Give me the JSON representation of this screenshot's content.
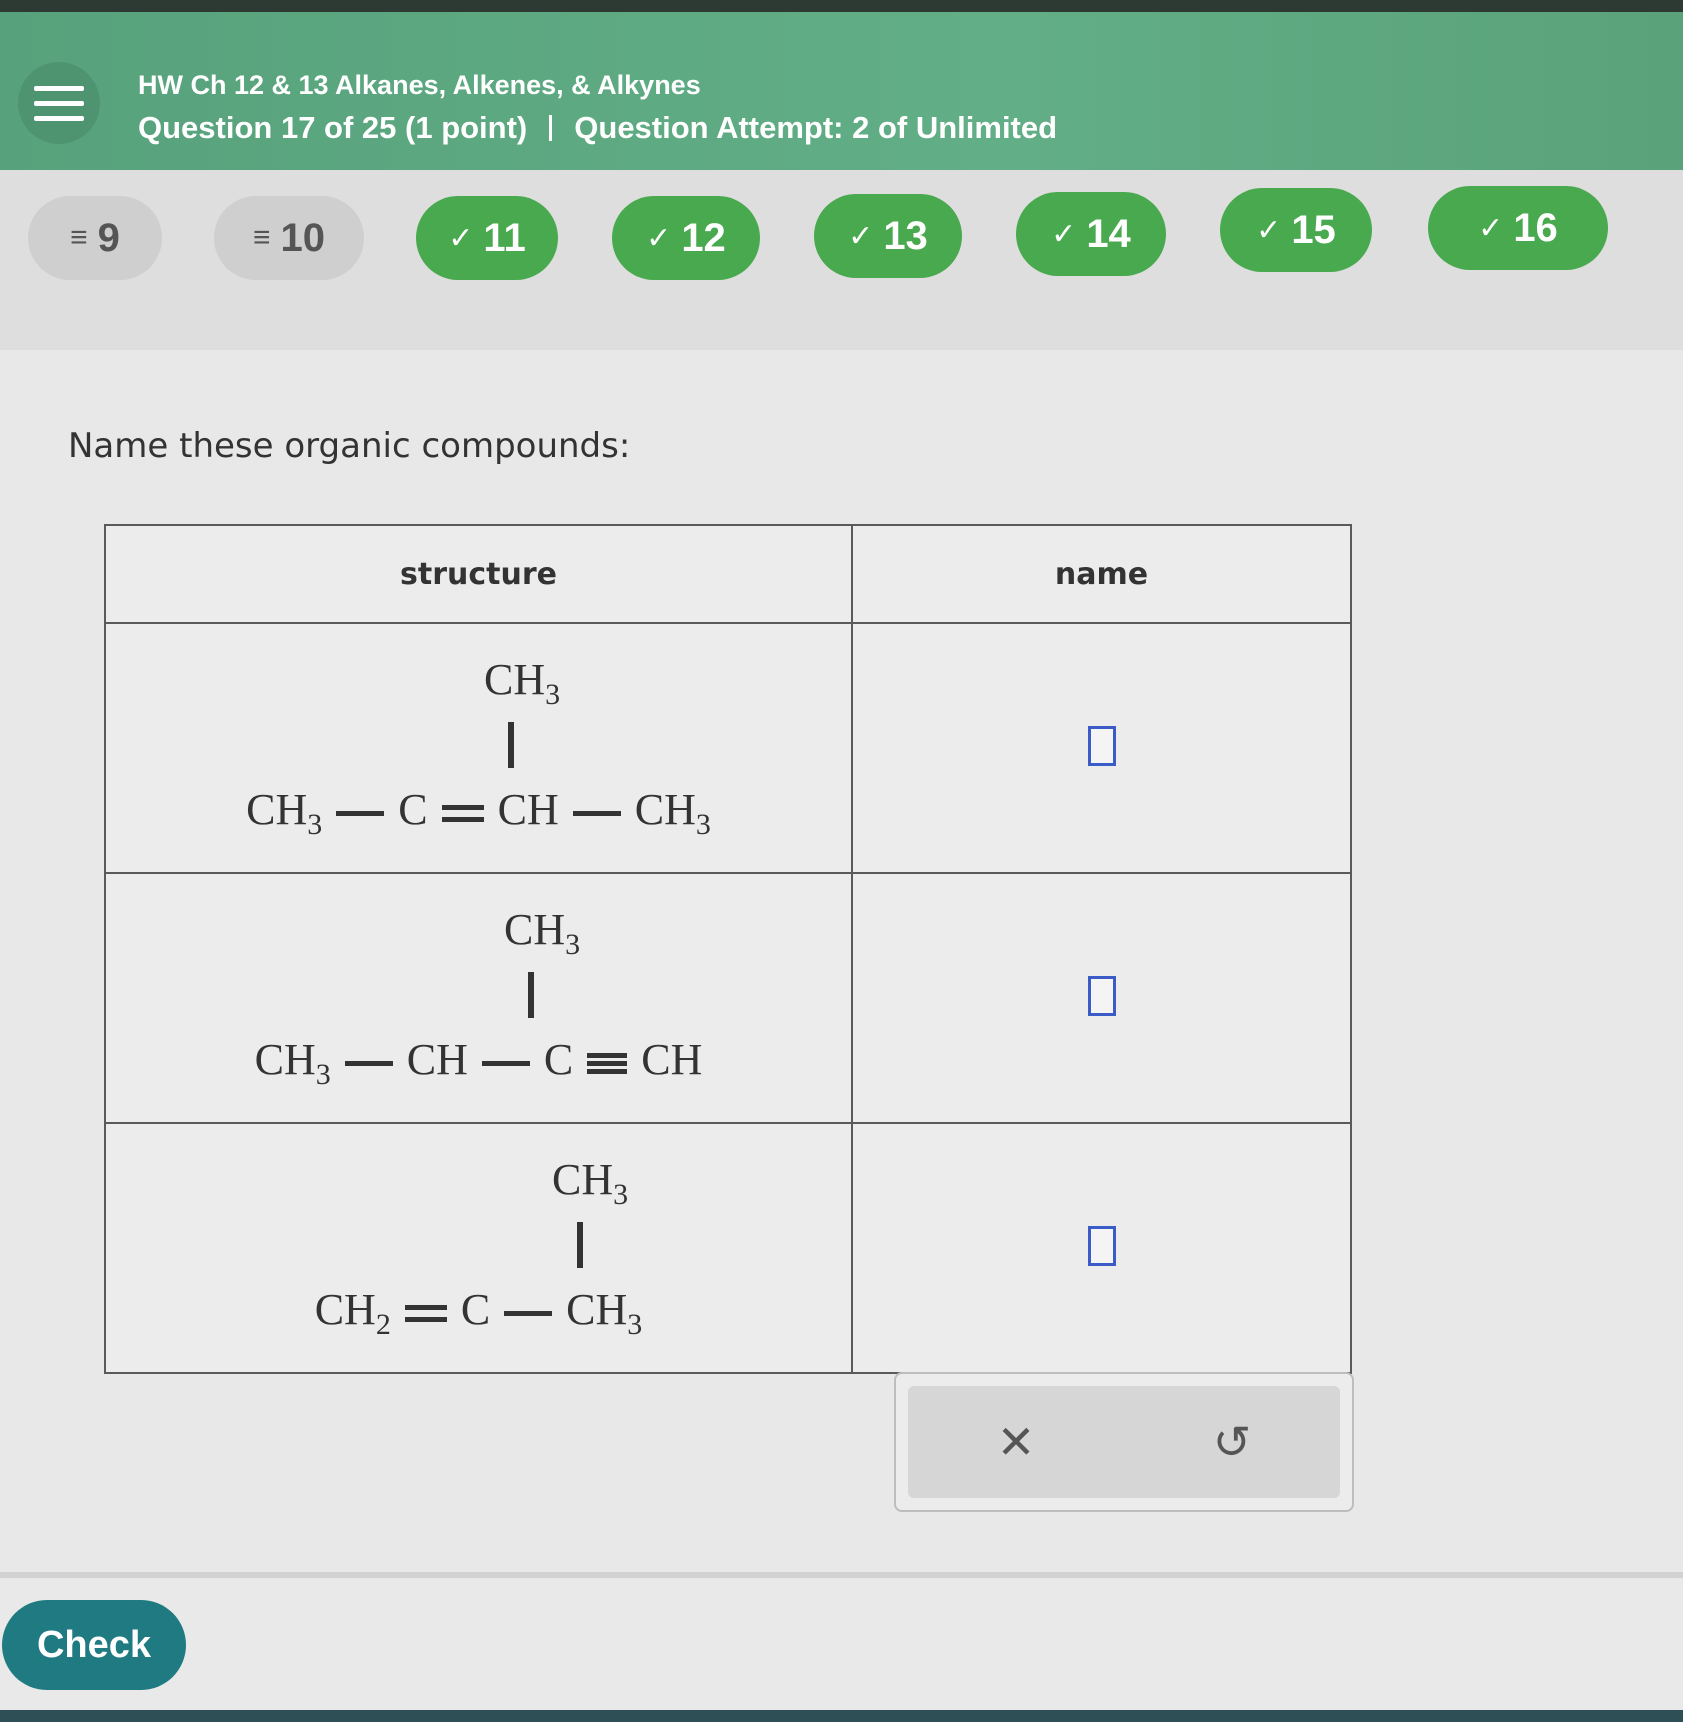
{
  "header": {
    "title": "HW Ch 12 & 13 Alkanes, Alkenes, & Alkynes",
    "question_info": "Question 17 of 25 (1 point)",
    "attempt_info": "Question Attempt: 2 of Unlimited"
  },
  "nav": {
    "questions": [
      {
        "number": "9",
        "status": "visited",
        "icon": "list-icon"
      },
      {
        "number": "10",
        "status": "visited",
        "icon": "list-icon"
      },
      {
        "number": "11",
        "status": "correct",
        "icon": "check-icon"
      },
      {
        "number": "12",
        "status": "correct",
        "icon": "check-icon"
      },
      {
        "number": "13",
        "status": "correct",
        "icon": "check-icon"
      },
      {
        "number": "14",
        "status": "correct",
        "icon": "check-icon"
      },
      {
        "number": "15",
        "status": "correct",
        "icon": "check-icon"
      },
      {
        "number": "16",
        "status": "correct",
        "icon": "check-icon"
      }
    ]
  },
  "question": {
    "prompt": "Name these organic compounds:",
    "table": {
      "headers": [
        "structure",
        "name"
      ],
      "rows": [
        {
          "branch": "CH",
          "branch_sub": "3",
          "chain": [
            [
              "CH",
              "3"
            ],
            "single",
            [
              "C",
              ""
            ],
            "double",
            [
              "CH",
              ""
            ],
            "single",
            [
              "CH",
              "3"
            ]
          ],
          "name_value": ""
        },
        {
          "branch": "CH",
          "branch_sub": "3",
          "chain": [
            [
              "CH",
              "3"
            ],
            "single",
            [
              "CH",
              ""
            ],
            "single",
            [
              "C",
              ""
            ],
            "triple",
            [
              "CH",
              ""
            ]
          ],
          "name_value": ""
        },
        {
          "branch": "CH",
          "branch_sub": "3",
          "chain": [
            [
              "CH",
              "2"
            ],
            "double",
            [
              "C",
              ""
            ],
            "single",
            [
              "CH",
              "3"
            ]
          ],
          "name_value": ""
        }
      ]
    }
  },
  "tools": {
    "clear_icon": "close-icon",
    "undo_icon": "undo-icon"
  },
  "footer": {
    "check_label": "Check"
  },
  "colors": {
    "header_green": "#5ea982",
    "correct_green": "#49a94f",
    "visited_gray": "#cfcfcf",
    "check_teal": "#1f7a82",
    "input_blue": "#3b5bc6"
  }
}
